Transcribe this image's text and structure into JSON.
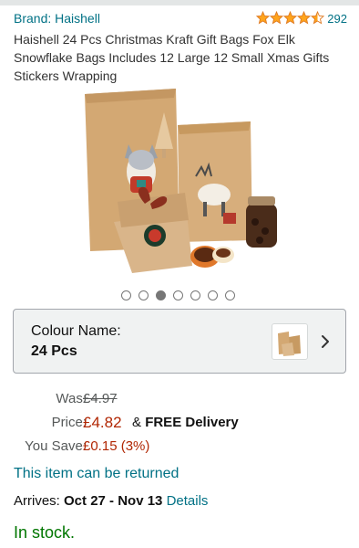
{
  "header": {
    "brand_label": "Brand: Haishell",
    "rating_value": 4.5,
    "rating_max": 5,
    "rating_count": "292"
  },
  "product": {
    "title": "Haishell 24 Pcs Christmas Kraft Gift Bags Fox Elk Snowflake Bags Includes 12 Large 12 Small Xmas Gifts Stickers Wrapping",
    "image_icon": "product-photo",
    "carousel": {
      "total": 7,
      "active_index": 2
    }
  },
  "variant": {
    "label": "Colour Name:",
    "value": "24 Pcs",
    "thumb_icon": "gift-bag-thumbnail",
    "chevron_icon": "chevron-right-icon"
  },
  "pricing": {
    "was_label": "Was:",
    "was_value": "£4.97",
    "price_label": "Price:",
    "price_value": "£4.82",
    "delivery_prefix": "&",
    "delivery_text": "FREE Delivery",
    "save_label": "You Save:",
    "save_value": "£0.15 (3%)"
  },
  "returns": {
    "text": "This item can be returned"
  },
  "delivery": {
    "arrives_label": "Arrives:",
    "arrives_dates": "Oct 27 - Nov 13",
    "details_link": "Details"
  },
  "stock": {
    "text": "In stock."
  },
  "colors": {
    "link": "#007185",
    "price": "#b12704",
    "in_stock": "#007600",
    "star": "#ffa41c"
  }
}
